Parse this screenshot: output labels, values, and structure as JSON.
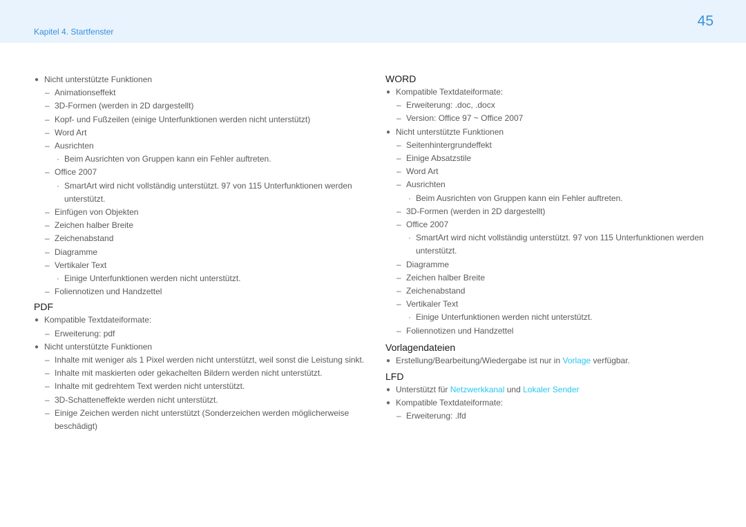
{
  "header": {
    "chapter": "Kapitel 4. Startfenster",
    "page_number": "45"
  },
  "left": {
    "intro": {
      "bullet": "Nicht unterstützte Funktionen",
      "items": [
        "Animationseffekt",
        "3D-Formen (werden in 2D dargestellt)",
        "Kopf- und Fußzeilen (einige Unterfunktionen werden nicht unterstützt)",
        "Word Art",
        "Ausrichten",
        "Beim Ausrichten von Gruppen kann ein Fehler auftreten.",
        "Office 2007",
        "SmartArt wird nicht vollständig unterstützt. 97 von 115 Unterfunktionen werden unterstützt.",
        "Einfügen von Objekten",
        "Zeichen halber Breite",
        "Zeichenabstand",
        "Diagramme",
        "Vertikaler Text",
        "Einige Unterfunktionen werden nicht unterstützt.",
        "Foliennotizen und Handzettel"
      ]
    },
    "pdf": {
      "heading": "PDF",
      "b1": "Kompatible Textdateiformate:",
      "b1_items": [
        "Erweiterung: pdf"
      ],
      "b2": "Nicht unterstützte Funktionen",
      "b2_items": [
        "Inhalte mit weniger als 1 Pixel werden nicht unterstützt, weil sonst die Leistung sinkt.",
        "Inhalte mit maskierten oder gekachelten Bildern werden nicht unterstützt.",
        "Inhalte mit gedrehtem Text werden nicht unterstützt.",
        "3D-Schatteneffekte werden nicht unterstützt.",
        "Einige Zeichen werden nicht unterstützt (Sonderzeichen werden möglicherweise",
        "beschädigt)"
      ]
    }
  },
  "right": {
    "word": {
      "heading": "WORD",
      "b1": "Kompatible Textdateiformate:",
      "b1_items": [
        "Erweiterung: .doc, .docx",
        "Version: Office 97 ~ Office 2007"
      ],
      "b2": "Nicht unterstützte Funktionen",
      "b2_items": [
        "Seitenhintergrundeffekt",
        "Einige Absatzstile",
        "Word Art",
        "Ausrichten",
        "Beim Ausrichten von Gruppen kann ein Fehler auftreten.",
        "3D-Formen (werden in 2D dargestellt)",
        "Office 2007",
        "SmartArt wird nicht vollständig unterstützt. 97 von 115 Unterfunktionen werden unterstützt.",
        "Diagramme",
        "Zeichen halber Breite",
        "Zeichenabstand",
        "Vertikaler Text",
        "Einige Unterfunktionen werden nicht unterstützt.",
        "Foliennotizen und Handzettel"
      ]
    },
    "templates": {
      "heading": "Vorlagendateien",
      "b1_pre": "Erstellung/Bearbeitung/Wiedergabe ist nur in ",
      "b1_link": "Vorlage",
      "b1_post": " verfügbar."
    },
    "lfd": {
      "heading": "LFD",
      "b1_pre": "Unterstützt für ",
      "b1_link1": "Netzwerkkanal",
      "b1_mid": " und ",
      "b1_link2": "Lokaler Sender",
      "b2": "Kompatible Textdateiformate:",
      "b2_items": [
        "Erweiterung: .lfd"
      ]
    }
  },
  "colors": {
    "header_bg": "#e8f3fd",
    "accent": "#3a8fe0",
    "link": "#27c6f0",
    "body_text": "#5a5a5a",
    "heading_text": "#1a1a1a"
  }
}
